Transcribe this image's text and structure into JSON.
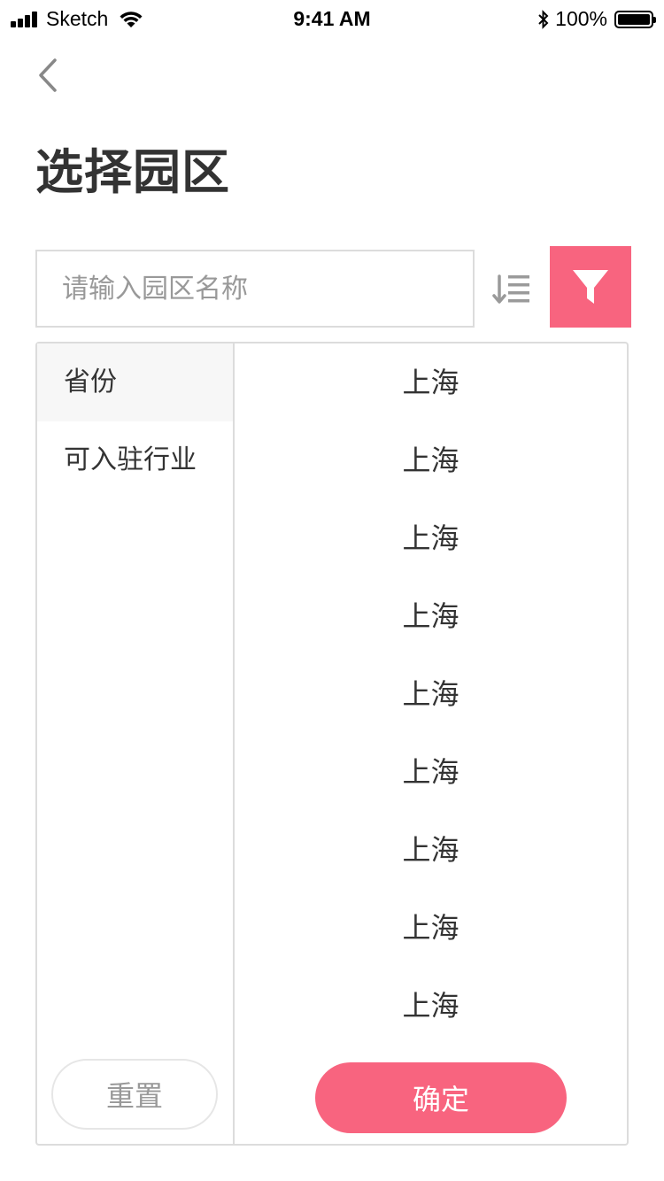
{
  "status_bar": {
    "carrier": "Sketch",
    "time": "9:41 AM",
    "battery": "100%"
  },
  "header": {
    "title": "选择园区",
    "back_icon": "chevron-left-icon"
  },
  "search": {
    "placeholder": "请输入园区名称",
    "value": ""
  },
  "toolbar": {
    "sort_icon": "sort-list-icon",
    "filter_icon": "funnel-icon"
  },
  "filter_panel": {
    "categories": [
      {
        "label": "省份",
        "active": true
      },
      {
        "label": "可入驻行业",
        "active": false
      }
    ],
    "options": [
      "上海",
      "上海",
      "上海",
      "上海",
      "上海",
      "上海",
      "上海",
      "上海",
      "上海"
    ],
    "reset_label": "重置",
    "confirm_label": "确定"
  },
  "colors": {
    "accent": "#f8647f",
    "text": "#333333",
    "placeholder": "#999999",
    "border": "#dcdcdc",
    "active_bg": "#f7f7f7"
  }
}
